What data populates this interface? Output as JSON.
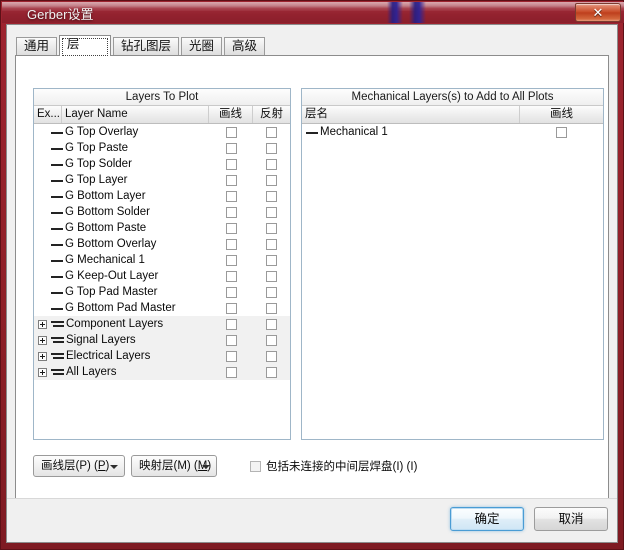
{
  "window": {
    "title": "Gerber设置",
    "close_glyph": "✕",
    "close_icon_name": "close-icon",
    "frame_color": "#8e2028",
    "accent_color": "#4a9cd4"
  },
  "tabs": [
    {
      "label": "通用",
      "selected": false
    },
    {
      "label": "层",
      "selected": true
    },
    {
      "label": "钻孔图层",
      "selected": false
    },
    {
      "label": "光圈",
      "selected": false
    },
    {
      "label": "高级",
      "selected": false
    }
  ],
  "left_panel": {
    "title": "Layers To Plot",
    "columns": [
      "Ex...",
      "Layer Name",
      "画线",
      "反射"
    ],
    "rows": [
      {
        "name": "G Top Overlay",
        "group": false,
        "plot": false,
        "mirror": false
      },
      {
        "name": "G Top Paste",
        "group": false,
        "plot": false,
        "mirror": false
      },
      {
        "name": "G Top Solder",
        "group": false,
        "plot": false,
        "mirror": false
      },
      {
        "name": "G Top Layer",
        "group": false,
        "plot": false,
        "mirror": false
      },
      {
        "name": "G Bottom Layer",
        "group": false,
        "plot": false,
        "mirror": false
      },
      {
        "name": "G Bottom Solder",
        "group": false,
        "plot": false,
        "mirror": false
      },
      {
        "name": "G Bottom Paste",
        "group": false,
        "plot": false,
        "mirror": false
      },
      {
        "name": "G Bottom Overlay",
        "group": false,
        "plot": false,
        "mirror": false
      },
      {
        "name": "G Mechanical 1",
        "group": false,
        "plot": false,
        "mirror": false
      },
      {
        "name": "G Keep-Out Layer",
        "group": false,
        "plot": false,
        "mirror": false
      },
      {
        "name": "G Top Pad Master",
        "group": false,
        "plot": false,
        "mirror": false
      },
      {
        "name": "G Bottom Pad Master",
        "group": false,
        "plot": false,
        "mirror": false
      },
      {
        "name": "Component Layers",
        "group": true,
        "plot": false,
        "mirror": false
      },
      {
        "name": "Signal Layers",
        "group": true,
        "plot": false,
        "mirror": false
      },
      {
        "name": "Electrical Layers",
        "group": true,
        "plot": false,
        "mirror": false
      },
      {
        "name": "All Layers",
        "group": true,
        "plot": false,
        "mirror": false
      }
    ]
  },
  "right_panel": {
    "title": "Mechanical Layers(s) to Add to All Plots",
    "columns": [
      "层名",
      "画线"
    ],
    "rows": [
      {
        "name": "Mechanical 1",
        "plot": false
      }
    ]
  },
  "bottom_controls": {
    "plot_layers_label": "画线层(P) (",
    "plot_layers_accel": "P",
    "plot_layers_suffix": ")",
    "mirror_layers_label": "映射层(M) (",
    "mirror_layers_accel": "M",
    "mirror_layers_suffix": ")",
    "include_checkbox_label": "包括未连接的中间层焊盘(I) (I)",
    "include_checked": false
  },
  "footer": {
    "ok_label": "确定",
    "cancel_label": "取消"
  }
}
